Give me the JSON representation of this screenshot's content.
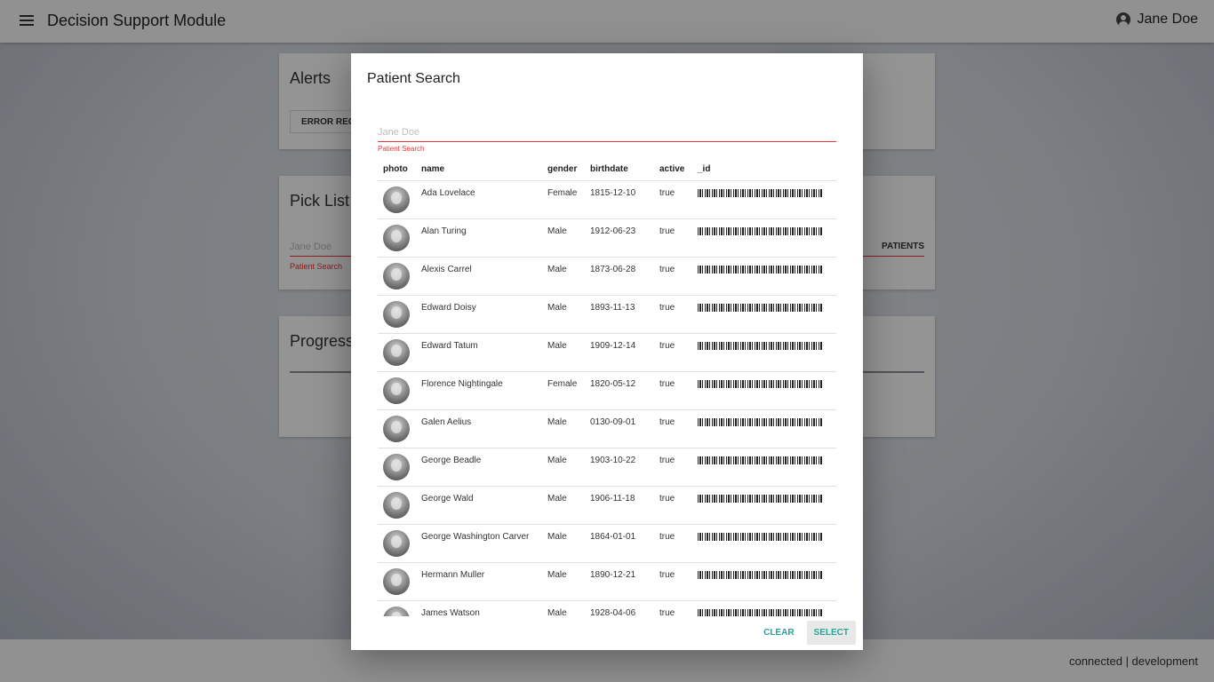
{
  "header": {
    "title": "Decision Support Module",
    "user_name": "Jane Doe"
  },
  "background_cards": {
    "alerts_title": "Alerts",
    "error_button": "ERROR RECORD",
    "pick_list_title": "Pick List",
    "pick_list_placeholder": "Jane Doe",
    "pick_list_helper": "Patient Search",
    "patients_button": "PATIENTS",
    "progress_title": "Progress"
  },
  "footer": {
    "status": "connected | development"
  },
  "dialog": {
    "title": "Patient Search",
    "search_placeholder": "Jane Doe",
    "search_helper": "Patient Search",
    "columns": [
      "photo",
      "name",
      "gender",
      "birthdate",
      "active",
      "_id"
    ],
    "rows": [
      {
        "name": "Ada Lovelace",
        "gender": "Female",
        "birthdate": "1815-12-10",
        "active": "true"
      },
      {
        "name": "Alan Turing",
        "gender": "Male",
        "birthdate": "1912-06-23",
        "active": "true"
      },
      {
        "name": "Alexis Carrel",
        "gender": "Male",
        "birthdate": "1873-06-28",
        "active": "true"
      },
      {
        "name": "Edward Doisy",
        "gender": "Male",
        "birthdate": "1893-11-13",
        "active": "true"
      },
      {
        "name": "Edward Tatum",
        "gender": "Male",
        "birthdate": "1909-12-14",
        "active": "true"
      },
      {
        "name": "Florence Nightingale",
        "gender": "Female",
        "birthdate": "1820-05-12",
        "active": "true"
      },
      {
        "name": "Galen Aelius",
        "gender": "Male",
        "birthdate": "0130-09-01",
        "active": "true"
      },
      {
        "name": "George Beadle",
        "gender": "Male",
        "birthdate": "1903-10-22",
        "active": "true"
      },
      {
        "name": "George Wald",
        "gender": "Male",
        "birthdate": "1906-11-18",
        "active": "true"
      },
      {
        "name": "George Washington Carver",
        "gender": "Male",
        "birthdate": "1864-01-01",
        "active": "true"
      },
      {
        "name": "Hermann Muller",
        "gender": "Male",
        "birthdate": "1890-12-21",
        "active": "true"
      },
      {
        "name": "James Watson",
        "gender": "Male",
        "birthdate": "1928-04-06",
        "active": "true"
      }
    ],
    "clear_label": "CLEAR",
    "select_label": "SELECT"
  },
  "colors": {
    "accent": "#26a69a",
    "error": "#e33333"
  }
}
